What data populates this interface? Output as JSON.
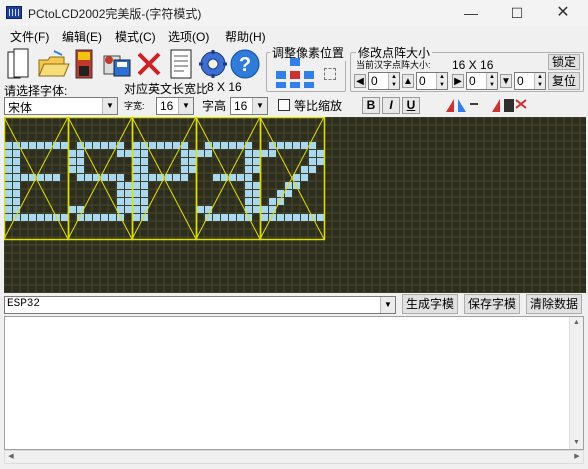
{
  "window": {
    "title": "PCtoLCD2002完美版-(字符模式)",
    "minimize_glyph": "—",
    "maximize_glyph": "☐",
    "close_glyph": "✕"
  },
  "menu": [
    "文件(F)",
    "编辑(E)",
    "模式(C)",
    "选项(O)",
    "帮助(H)"
  ],
  "toolbar_icons": [
    "new-file-icon",
    "open-folder-icon",
    "save-disk-icon",
    "save-as-icon",
    "delete-x-icon",
    "notes-icon",
    "settings-gear-icon",
    "help-icon"
  ],
  "adjust_group": {
    "title": "调整像素位置"
  },
  "resize_group": {
    "title": "修改点阵大小",
    "current_label": "当前汉字点阵大小:",
    "current_size": "16 X 16",
    "lock_label": "锁定",
    "restore_label": "复位",
    "spinners": [
      "0",
      "0",
      "0",
      "0"
    ]
  },
  "font": {
    "select_label": "请选择字体:",
    "ascii_width_label": "对应英文长宽比",
    "ascii_size": "8 X 16",
    "font_name": "宋体",
    "char_width_label": "字宽:",
    "char_width": "16",
    "char_height_label": "字高",
    "char_height": "16",
    "scale_label": "等比缩放"
  },
  "format_buttons": [
    "B",
    "I",
    "U"
  ],
  "grid": {
    "background": "#2e2e20",
    "grid_line": "#4a4a2a",
    "lit_color": "#a8d8f0",
    "frame_color": "#e0e000",
    "text": "ESP32"
  },
  "input": {
    "text": "ESP32",
    "generate_button": "生成字模",
    "save_button": "保存字模",
    "clear_button": "清除数据"
  }
}
